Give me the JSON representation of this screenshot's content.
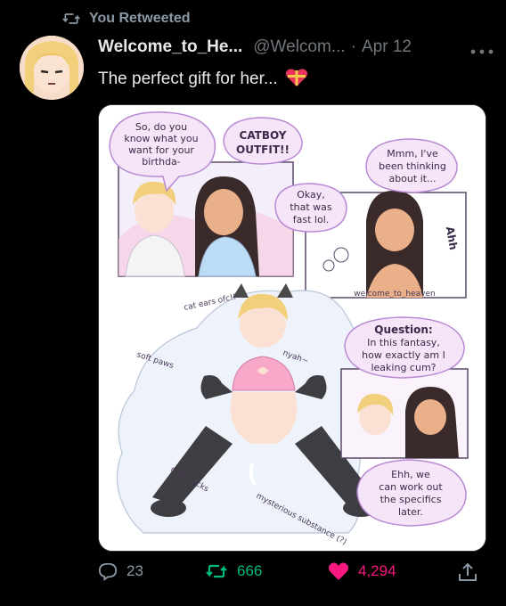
{
  "retweet_banner": {
    "label": "You Retweeted",
    "icon": "retweet-icon"
  },
  "author": {
    "name": "Welcome_to_He...",
    "handle": "@Welcom...",
    "separator": "·",
    "date": "Apr 12"
  },
  "more_icon": "more-horizontal-icon",
  "tweet": {
    "text": "The perfect gift for her...",
    "emoji_icon": "gift-heart-icon"
  },
  "comic": {
    "panel1": {
      "bubble_left": [
        "So, do you",
        "know what you",
        "want for your",
        "birthda-"
      ],
      "bubble_right": [
        "CATBOY",
        "OUTFIT!!"
      ],
      "bubble_small": [
        "Okay,",
        "that was",
        "fast lol."
      ]
    },
    "panel2": {
      "bubble": [
        "Mmm, I've",
        "been thinking",
        "about it..."
      ],
      "sfx": "Ahh",
      "credit": "welcome_to_heaven"
    },
    "fantasy": {
      "note_ears": "cat ears ofc!!",
      "note_paws": "soft paws",
      "note_socks": "cute socks",
      "note_substance": "mysterious substance (?)",
      "sfx": "nyah~"
    },
    "panel3": {
      "bubble": [
        "Question:",
        "In this fantasy,",
        "how exactly am I",
        "leaking cum?"
      ]
    },
    "panel4": {
      "bubble": [
        "Ehh, we",
        "can work out",
        "the specifics",
        "later."
      ]
    }
  },
  "actions": {
    "reply": {
      "icon": "reply-icon",
      "count": "23"
    },
    "retweet": {
      "icon": "retweet-icon",
      "count": "666"
    },
    "like": {
      "icon": "heart-filled-icon",
      "count": "4,294"
    },
    "share": {
      "icon": "share-icon"
    }
  },
  "colors": {
    "retweet": "#00ba7c",
    "like": "#f91880",
    "muted": "#71767b",
    "bubble_fill": "#f6e4f8",
    "bubble_stroke": "#b98ad4"
  }
}
